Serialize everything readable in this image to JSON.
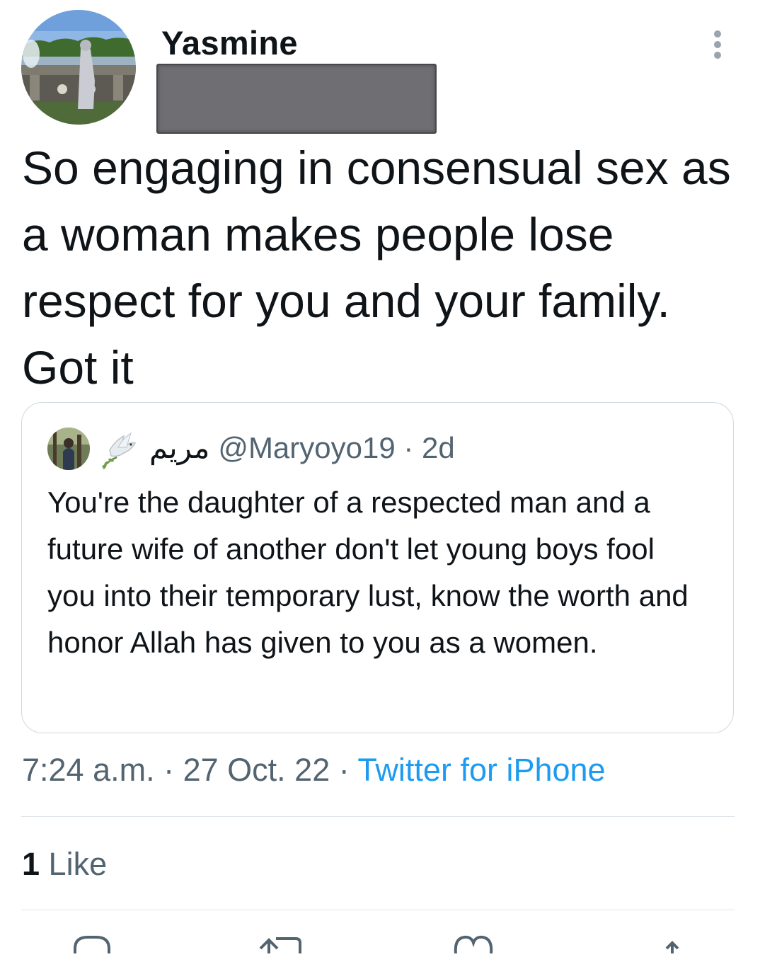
{
  "tweet": {
    "author_name": "Yasmine",
    "text": "So engaging in consensual sex as a woman makes people lose respect for you and your family. Got it",
    "timestamp": "7:24 a.m.",
    "separator": " · ",
    "date": "27 Oct. 22",
    "source": "Twitter for iPhone",
    "likes_count": "1",
    "likes_label": "Like"
  },
  "quoted_tweet": {
    "display_name": "مريم",
    "handle": "@Maryoyo19",
    "separator": " · ",
    "age": "2d",
    "text": "You're the daughter of a respected man and a future wife of another don't let young boys fool you into their temporary lust, know the worth and honor Allah has given to you as a women."
  },
  "icons": {
    "more": "more-vertical-icon",
    "reply": "reply-icon",
    "retweet": "retweet-icon",
    "like": "heart-icon",
    "share": "share-icon",
    "badge": "dove-icon"
  },
  "colors": {
    "text_primary": "#0f1419",
    "text_secondary": "#536471",
    "link": "#1d9bf0",
    "border": "#cfd9de"
  }
}
